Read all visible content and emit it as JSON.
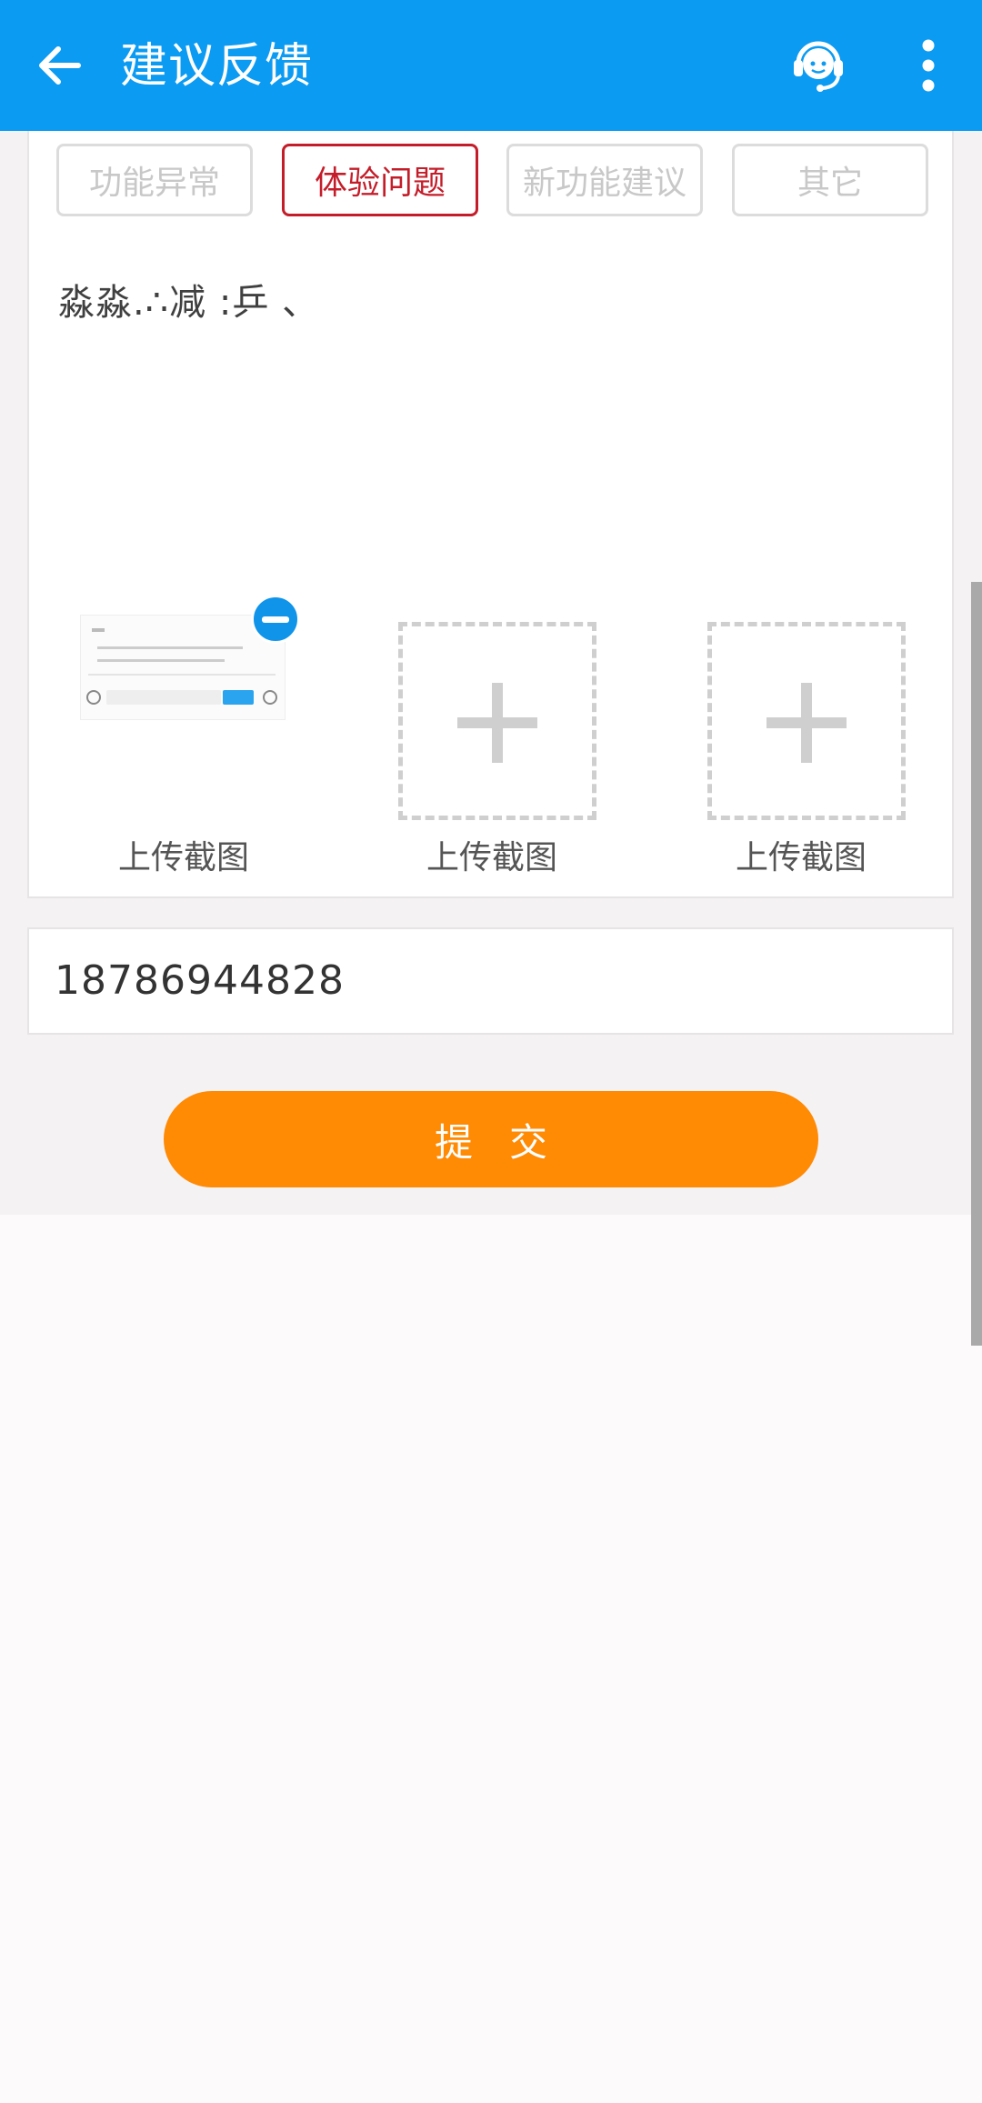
{
  "header": {
    "title": "建议反馈",
    "background": "#0b9bf2"
  },
  "feedback_types": [
    {
      "label": "功能异常",
      "selected": false
    },
    {
      "label": "体验问题",
      "selected": true
    },
    {
      "label": "新功能建议",
      "selected": false
    },
    {
      "label": "其它",
      "selected": false
    }
  ],
  "feedback": {
    "text": "淼淼.∴减 :乒 、"
  },
  "uploads": [
    {
      "label": "上传截图",
      "state": "filled"
    },
    {
      "label": "上传截图",
      "state": "empty"
    },
    {
      "label": "上传截图",
      "state": "empty"
    }
  ],
  "contact": {
    "phone": "18786944828"
  },
  "submit": {
    "label": "提交",
    "color": "#ff8a04"
  },
  "colors": {
    "selected_border": "#c41d2a",
    "accent_blue": "#0b9bf2"
  }
}
